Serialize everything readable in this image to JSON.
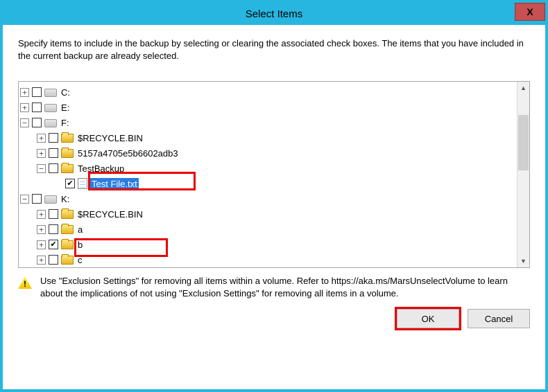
{
  "titlebar": {
    "title": "Select Items",
    "close": "X"
  },
  "instructions": "Specify items to include in the backup by selecting or clearing the associated check boxes. The items that you have included in the current backup are already selected.",
  "tree": {
    "drives": {
      "c": "C:",
      "e": "E:",
      "f": "F:",
      "k": "K:"
    },
    "f_children": {
      "recycle": "$RECYCLE.BIN",
      "hash": "5157a4705e5b6602adb3",
      "testbackup": "TestBackup",
      "testfile": "Test File.txt"
    },
    "k_children": {
      "recycle": "$RECYCLE.BIN",
      "a": "a",
      "b": "b",
      "c": "c"
    }
  },
  "info": "Use \"Exclusion Settings\" for removing all items within a volume. Refer to https://aka.ms/MarsUnselectVolume to learn about the implications of not using \"Exclusion Settings\" for removing all items in a volume.",
  "buttons": {
    "ok": "OK",
    "cancel": "Cancel"
  }
}
